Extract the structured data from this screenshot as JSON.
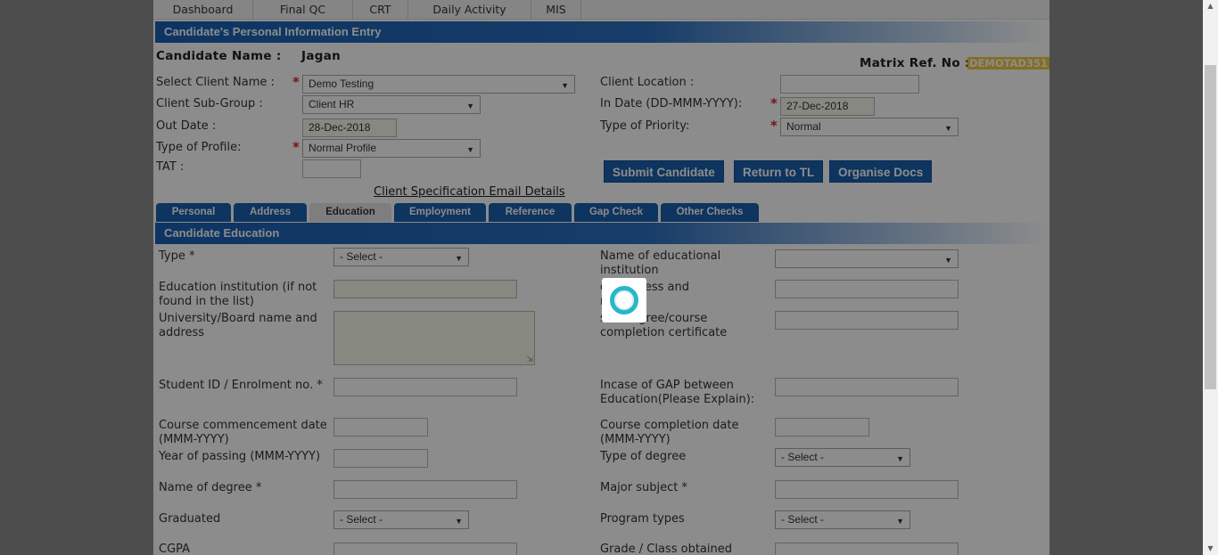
{
  "nav": [
    "Dashboard",
    "Final QC",
    "CRT",
    "Daily Activity",
    "MIS"
  ],
  "section_title": "Candidate's Personal Information Entry",
  "candidate": {
    "label": "Candidate Name :",
    "value": "Jagan"
  },
  "matrix": {
    "label": "Matrix Ref. No :",
    "value": "DEMOTAD351"
  },
  "form": {
    "client_name": {
      "label": "Select Client Name :",
      "value": "Demo Testing"
    },
    "client_sub_group": {
      "label": "Client Sub-Group :",
      "value": "Client HR"
    },
    "out_date": {
      "label": "Out Date :",
      "value": "28-Dec-2018"
    },
    "type_of_profile": {
      "label": "Type of Profile:",
      "value": "Normal Profile"
    },
    "tat": {
      "label": "TAT :",
      "value": ""
    },
    "client_location": {
      "label": "Client Location :",
      "value": ""
    },
    "in_date": {
      "label": "In Date (DD-MMM-YYYY):",
      "value": "27-Dec-2018"
    },
    "type_of_priority": {
      "label": "Type of Priority:",
      "value": "Normal"
    }
  },
  "buttons": {
    "submit": "Submit Candidate",
    "return": "Return to TL",
    "organise": "Organise Docs"
  },
  "client_spec_link": "Client Specification Email Details",
  "tabs": [
    "Personal",
    "Address",
    "Education",
    "Employment",
    "Reference",
    "Gap Check",
    "Other Checks"
  ],
  "active_tab": "Education",
  "education": {
    "title": "Candidate Education",
    "type_label": "Type *",
    "type_value": "- Select -",
    "institution_name_label": "Name of educational institution",
    "institution_other_label": "Education institution (if not found in the list)",
    "institution_address_label_visible": "on address and\nno.",
    "university_label": "University/Board name and address",
    "degree_certificate_label_visible": "s in degree/course\ncompletion certificate",
    "student_id_label": "Student ID / Enrolment no. *",
    "gap_label": "Incase of GAP between Education(Please Explain):",
    "course_commencement_label": "Course commencement date (MMM-YYYY)",
    "course_completion_label": "Course completion date (MMM-YYYY)",
    "year_of_passing_label": "Year of passing (MMM-YYYY)",
    "type_of_degree_label": "Type of degree",
    "type_of_degree_value": "- Select -",
    "name_of_degree_label": "Name of degree *",
    "major_subject_label": "Major subject *",
    "graduated_label": "Graduated",
    "graduated_value": "- Select -",
    "program_types_label": "Program types",
    "program_types_value": "- Select -",
    "cgpa_label": "CGPA",
    "grade_label": "Grade / Class obtained"
  },
  "colors": {
    "header_blue": "#1960b3",
    "button_blue": "#1b5fb0",
    "required_red": "#e02020",
    "spinner": "#29b6c6"
  }
}
